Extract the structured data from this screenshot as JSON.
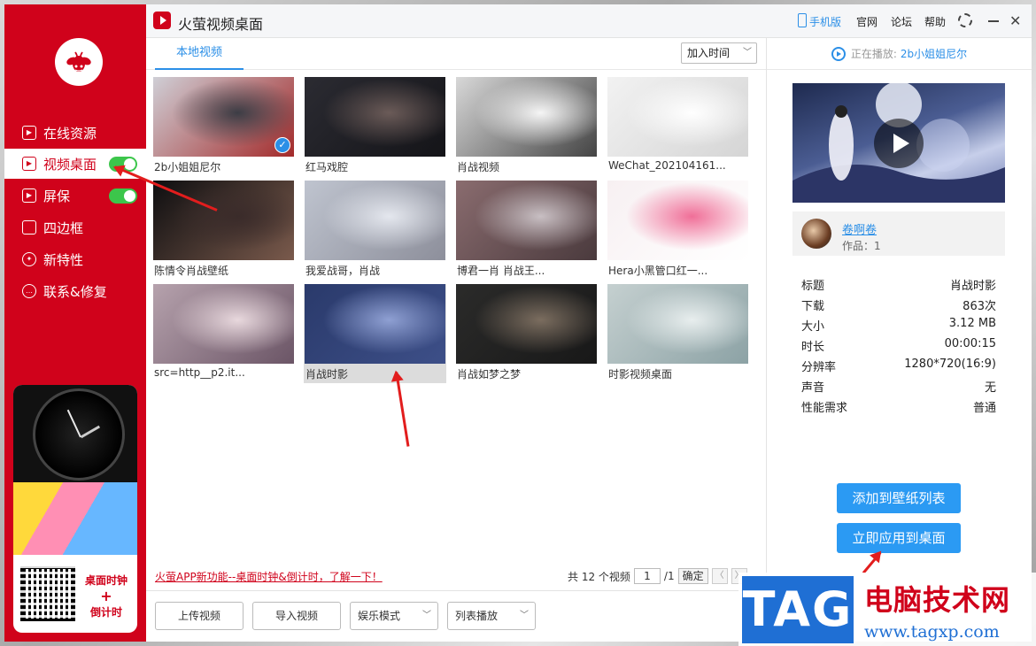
{
  "app": {
    "title": "火萤视频桌面",
    "links": [
      "手机版",
      "官网",
      "论坛",
      "帮助"
    ],
    "accent": "#d0021b",
    "blue": "#2b8fe7"
  },
  "sidebar": {
    "items": [
      {
        "label": "在线资源",
        "icon": "play-square-icon"
      },
      {
        "label": "视频桌面",
        "icon": "play-square-icon",
        "active": true,
        "toggle": true
      },
      {
        "label": "屏保",
        "icon": "play-square-icon",
        "toggle": true
      },
      {
        "label": "四边框",
        "icon": "frame-icon"
      },
      {
        "label": "新特性",
        "icon": "feature-icon"
      },
      {
        "label": "联系&修复",
        "icon": "chat-icon"
      }
    ],
    "promo": {
      "line1": "桌面时钟",
      "plus": "+",
      "line2": "倒计时"
    }
  },
  "main": {
    "tab": "本地视频",
    "sort": "加入时间",
    "videos": [
      {
        "caption": "2b小姐姐尼尔",
        "checked": true,
        "colors": [
          "#cfcfd6",
          "#3c3d45",
          "#a32a2a"
        ]
      },
      {
        "caption": "红马戏腔",
        "colors": [
          "#2b2b32",
          "#6b5b58",
          "#141418"
        ]
      },
      {
        "caption": "肖战视频",
        "colors": [
          "#d8d8d8",
          "#f5f5f5",
          "#444"
        ]
      },
      {
        "caption": "WeChat_202104161...",
        "colors": [
          "#f2f2f2",
          "#ffffff",
          "#d5d5d5"
        ]
      },
      {
        "caption": "陈情令肖战壁纸",
        "colors": [
          "#0e0e10",
          "#3a2b2a",
          "#7a5a4c"
        ]
      },
      {
        "caption": "我爱战哥，肖战",
        "colors": [
          "#bfc4cf",
          "#e4e7ee",
          "#8d8f9b"
        ]
      },
      {
        "caption": "博君一肖 肖战王...",
        "colors": [
          "#8a6c6f",
          "#c8bfc3",
          "#4a3a3d"
        ]
      },
      {
        "caption": "Hera小黑管口红一...",
        "colors": [
          "#f7f0f2",
          "#f06f98",
          "#ffffff"
        ]
      },
      {
        "caption": "src=http__p2.it...",
        "colors": [
          "#b6a2ad",
          "#e8d8dd",
          "#6b5566"
        ]
      },
      {
        "caption": "肖战时影",
        "selected": true,
        "colors": [
          "#2a3a6b",
          "#8fa0d3",
          "#3d4f88"
        ]
      },
      {
        "caption": "肖战如梦之梦",
        "colors": [
          "#2b2b2a",
          "#7b6d5f",
          "#181818"
        ]
      },
      {
        "caption": "时影视频桌面",
        "colors": [
          "#c5d0d0",
          "#e8eeee",
          "#8ca2a5"
        ]
      }
    ],
    "promo_link": "火萤APP新功能--桌面时钟&倒计时，了解一下！",
    "pager": {
      "total": "共 12 个视频",
      "page": "1",
      "pages": "/1",
      "ok": "确定"
    },
    "buttons": {
      "upload": "上传视频",
      "import": "导入视频",
      "mode": "娱乐模式",
      "playlist": "列表播放"
    }
  },
  "right": {
    "now_label": "正在播放:",
    "now_value": "2b小姐姐尼尔",
    "author": {
      "name": "卷啊卷",
      "works": "作品：1"
    },
    "info": [
      {
        "k": "标题",
        "v": "肖战时影"
      },
      {
        "k": "下载",
        "v": "863次"
      },
      {
        "k": "大小",
        "v": "3.12 MB"
      },
      {
        "k": "时长",
        "v": "00:00:15"
      },
      {
        "k": "分辨率",
        "v": "1280*720(16:9)"
      },
      {
        "k": "声音",
        "v": "无"
      },
      {
        "k": "性能需求",
        "v": "普通"
      }
    ],
    "btn_add": "添加到壁纸列表",
    "btn_apply": "立即应用到桌面"
  },
  "watermark": {
    "tag": "TAG",
    "text": "电脑技术网",
    "url": "www.tagxp.com"
  }
}
